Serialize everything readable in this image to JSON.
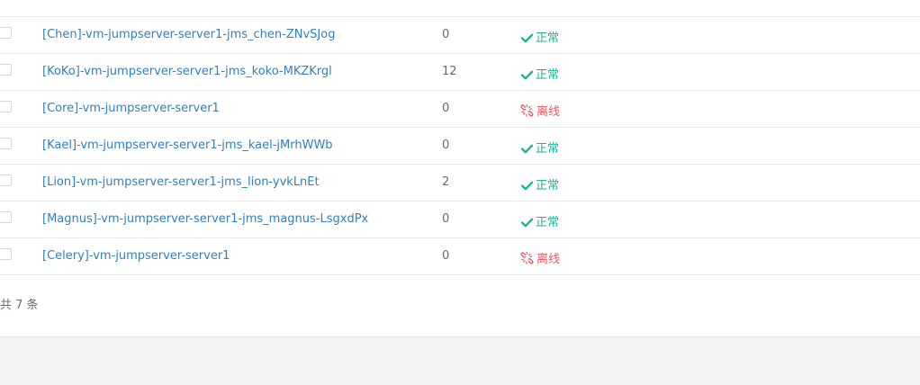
{
  "terminals": [
    {
      "name": "[Chen]-vm-jumpserver-server1-jms_chen-ZNvSJog",
      "sessions": "0",
      "status": "正常",
      "status_type": "ok",
      "status_icon": "check-icon"
    },
    {
      "name": "[KoKo]-vm-jumpserver-server1-jms_koko-MKZKrgl",
      "sessions": "12",
      "status": "正常",
      "status_type": "ok",
      "status_icon": "check-icon"
    },
    {
      "name": "[Core]-vm-jumpserver-server1",
      "sessions": "0",
      "status": "离线",
      "status_type": "offline",
      "status_icon": "broken-link-icon"
    },
    {
      "name": "[Kael]-vm-jumpserver-server1-jms_kael-jMrhWWb",
      "sessions": "0",
      "status": "正常",
      "status_type": "ok",
      "status_icon": "check-icon"
    },
    {
      "name": "[Lion]-vm-jumpserver-server1-jms_lion-yvkLnEt",
      "sessions": "2",
      "status": "正常",
      "status_type": "ok",
      "status_icon": "check-icon"
    },
    {
      "name": "[Magnus]-vm-jumpserver-server1-jms_magnus-LsgxdPx",
      "sessions": "0",
      "status": "正常",
      "status_type": "ok",
      "status_icon": "check-icon"
    },
    {
      "name": "[Celery]-vm-jumpserver-server1",
      "sessions": "0",
      "status": "离线",
      "status_type": "offline",
      "status_icon": "broken-link-icon"
    }
  ],
  "footer": {
    "total_text": "共 7 条"
  },
  "colors": {
    "link": "#2f7fc0",
    "ok": "#1ab394",
    "offline": "#ed5565",
    "text": "#676a6c",
    "border": "#e7eaec",
    "background": "#f3f3f4"
  }
}
